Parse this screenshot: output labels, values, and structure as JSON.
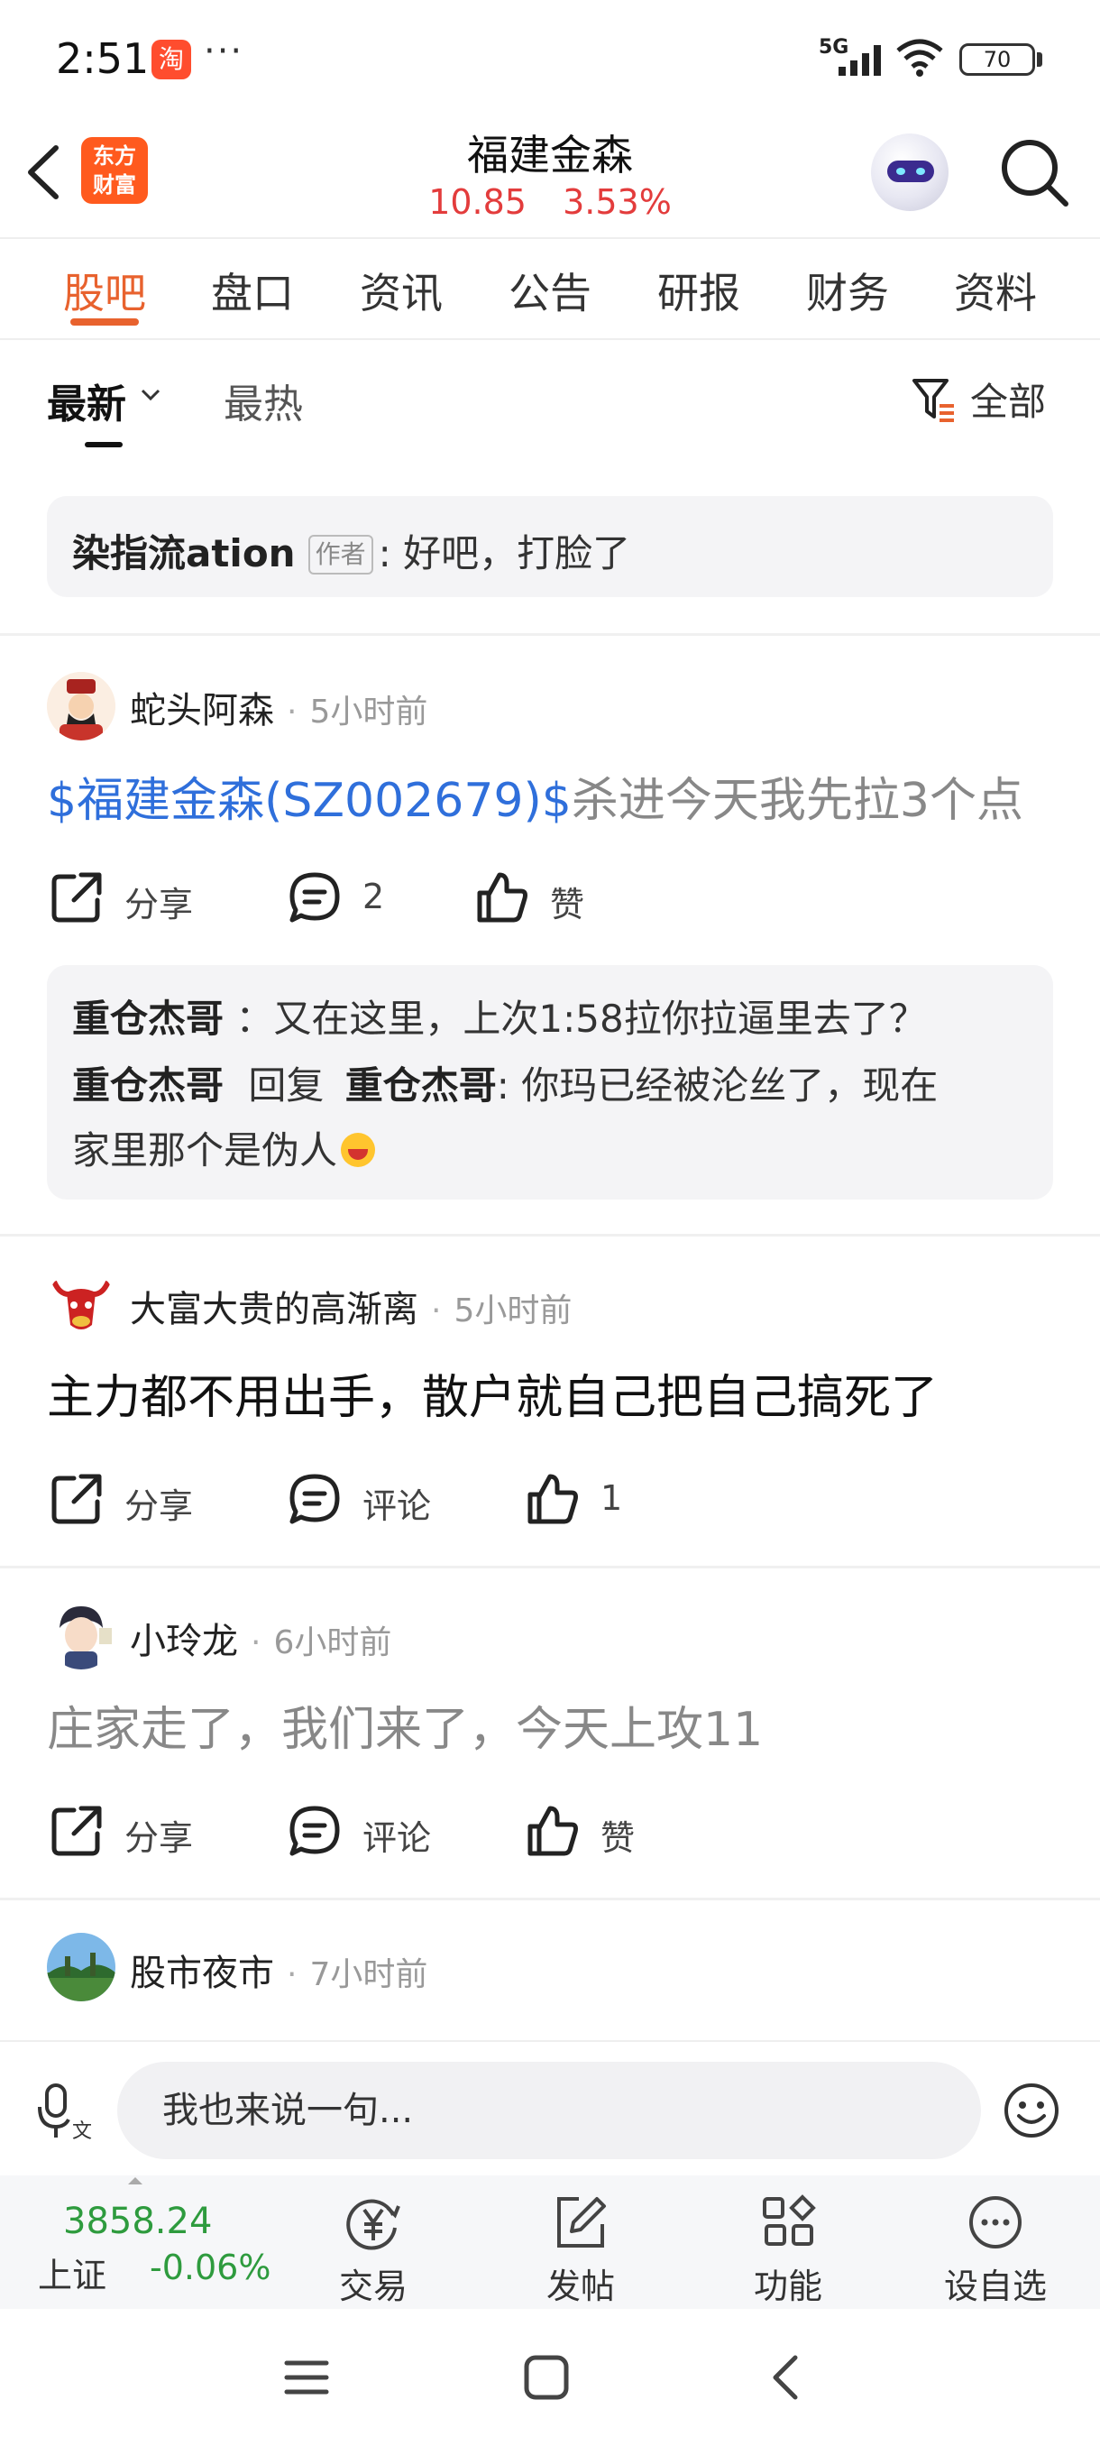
{
  "status_bar": {
    "time": "2:51",
    "app_badge": "淘",
    "more": "···",
    "network": "5G",
    "battery": "70"
  },
  "header": {
    "logo_line1": "东方",
    "logo_line2": "财富",
    "stock_name": "福建金森",
    "price": "10.85",
    "change_pct": "3.53%",
    "price_color": "#e33c3c"
  },
  "tabs": [
    {
      "label": "股吧",
      "active": true
    },
    {
      "label": "盘口"
    },
    {
      "label": "资讯"
    },
    {
      "label": "公告"
    },
    {
      "label": "研报"
    },
    {
      "label": "财务"
    },
    {
      "label": "资料"
    }
  ],
  "sort": {
    "newest": "最新",
    "hottest": "最热",
    "filter": "全部"
  },
  "pinned": {
    "author": "染指流ation",
    "badge": "作者",
    "text": ": 好吧，打脸了"
  },
  "posts": [
    {
      "user": "蛇头阿森",
      "time": "5小时前",
      "tag": "$福建金森(SZ002679)$",
      "text": "杀进今天我先拉3个点",
      "share": "分享",
      "comments": "2",
      "likes": "赞",
      "replies": [
        {
          "name": "重仓杰哥",
          "text": "：又在这里，上次1:58拉你拉逼里去了？"
        },
        {
          "name": "重仓杰哥",
          "reply_word": "回复",
          "target": "重仓杰哥",
          "text": ": 你玛已经被沦丝了，现在",
          "text2": "家里那个是伪人"
        }
      ]
    },
    {
      "user": "大富大贵的高渐离",
      "time": "5小时前",
      "text": "主力都不用出手，散户就自己把自己搞死了",
      "share": "分享",
      "comments": "评论",
      "likes": "1"
    },
    {
      "user": "小玲龙",
      "time": "6小时前",
      "text": "庄家走了，我们来了，今天上攻11",
      "share": "分享",
      "comments": "评论",
      "likes": "赞"
    },
    {
      "user": "股市夜市",
      "time": "7小时前"
    }
  ],
  "input": {
    "placeholder": "我也来说一句..."
  },
  "bottom_bar": {
    "index_value": "3858.24",
    "index_name": "上证",
    "index_change": "-0.06%",
    "index_color": "#2e9b3e",
    "nav": [
      {
        "label": "交易",
        "icon": "yen-exchange-icon"
      },
      {
        "label": "发帖",
        "icon": "edit-post-icon"
      },
      {
        "label": "功能",
        "icon": "grid-apps-icon"
      },
      {
        "label": "设自选",
        "icon": "more-dots-icon"
      }
    ]
  }
}
